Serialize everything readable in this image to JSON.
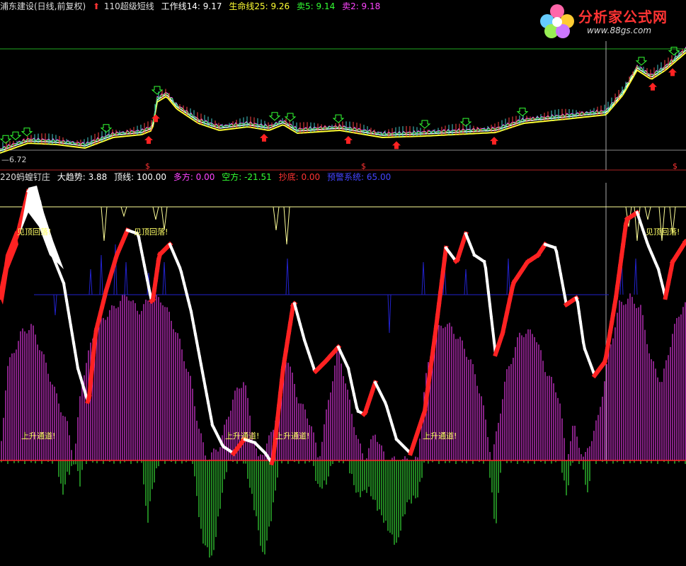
{
  "header": {
    "stock_title": "浦东建设(日线,前复权)",
    "indicator_name": "110超级短线",
    "lines": [
      {
        "label": "工作线14: 9.17",
        "color": "#ffffff"
      },
      {
        "label": "生命线25: 9.26",
        "color": "#ffff33"
      },
      {
        "label": "卖5: 9.14",
        "color": "#33ff33"
      },
      {
        "label": "卖2: 9.18",
        "color": "#ff44ff"
      }
    ]
  },
  "price_panel": {
    "low_label": "6.72",
    "sell_markers": 13,
    "buy_markers": 8
  },
  "lower_header": {
    "indicator_name": "220蚂蝗钉庄",
    "values": [
      {
        "label": "大趋势: 3.88",
        "color": "#ffffff"
      },
      {
        "label": "顶线: 100.00",
        "color": "#ffffff"
      },
      {
        "label": "多方: 0.00",
        "color": "#ff44ff"
      },
      {
        "label": "空方: -21.51",
        "color": "#33ff33"
      },
      {
        "label": "抄底: 0.00",
        "color": "#ff3333"
      },
      {
        "label": "预警系统: 65.00",
        "color": "#4444ff"
      }
    ]
  },
  "annotations": {
    "top_fall": "见顶回落!",
    "up_channel": "上升通道!"
  },
  "logo": {
    "title": "分析家公式网",
    "url": "www.88gs.com"
  },
  "colors": {
    "background": "#000000",
    "bull": "#ff2222",
    "bear": "#ffffff",
    "macd_pos": "#cc33cc",
    "macd_neg": "#33cc33",
    "warning_line": "#2222cc",
    "top_line": "#ffff99"
  }
}
